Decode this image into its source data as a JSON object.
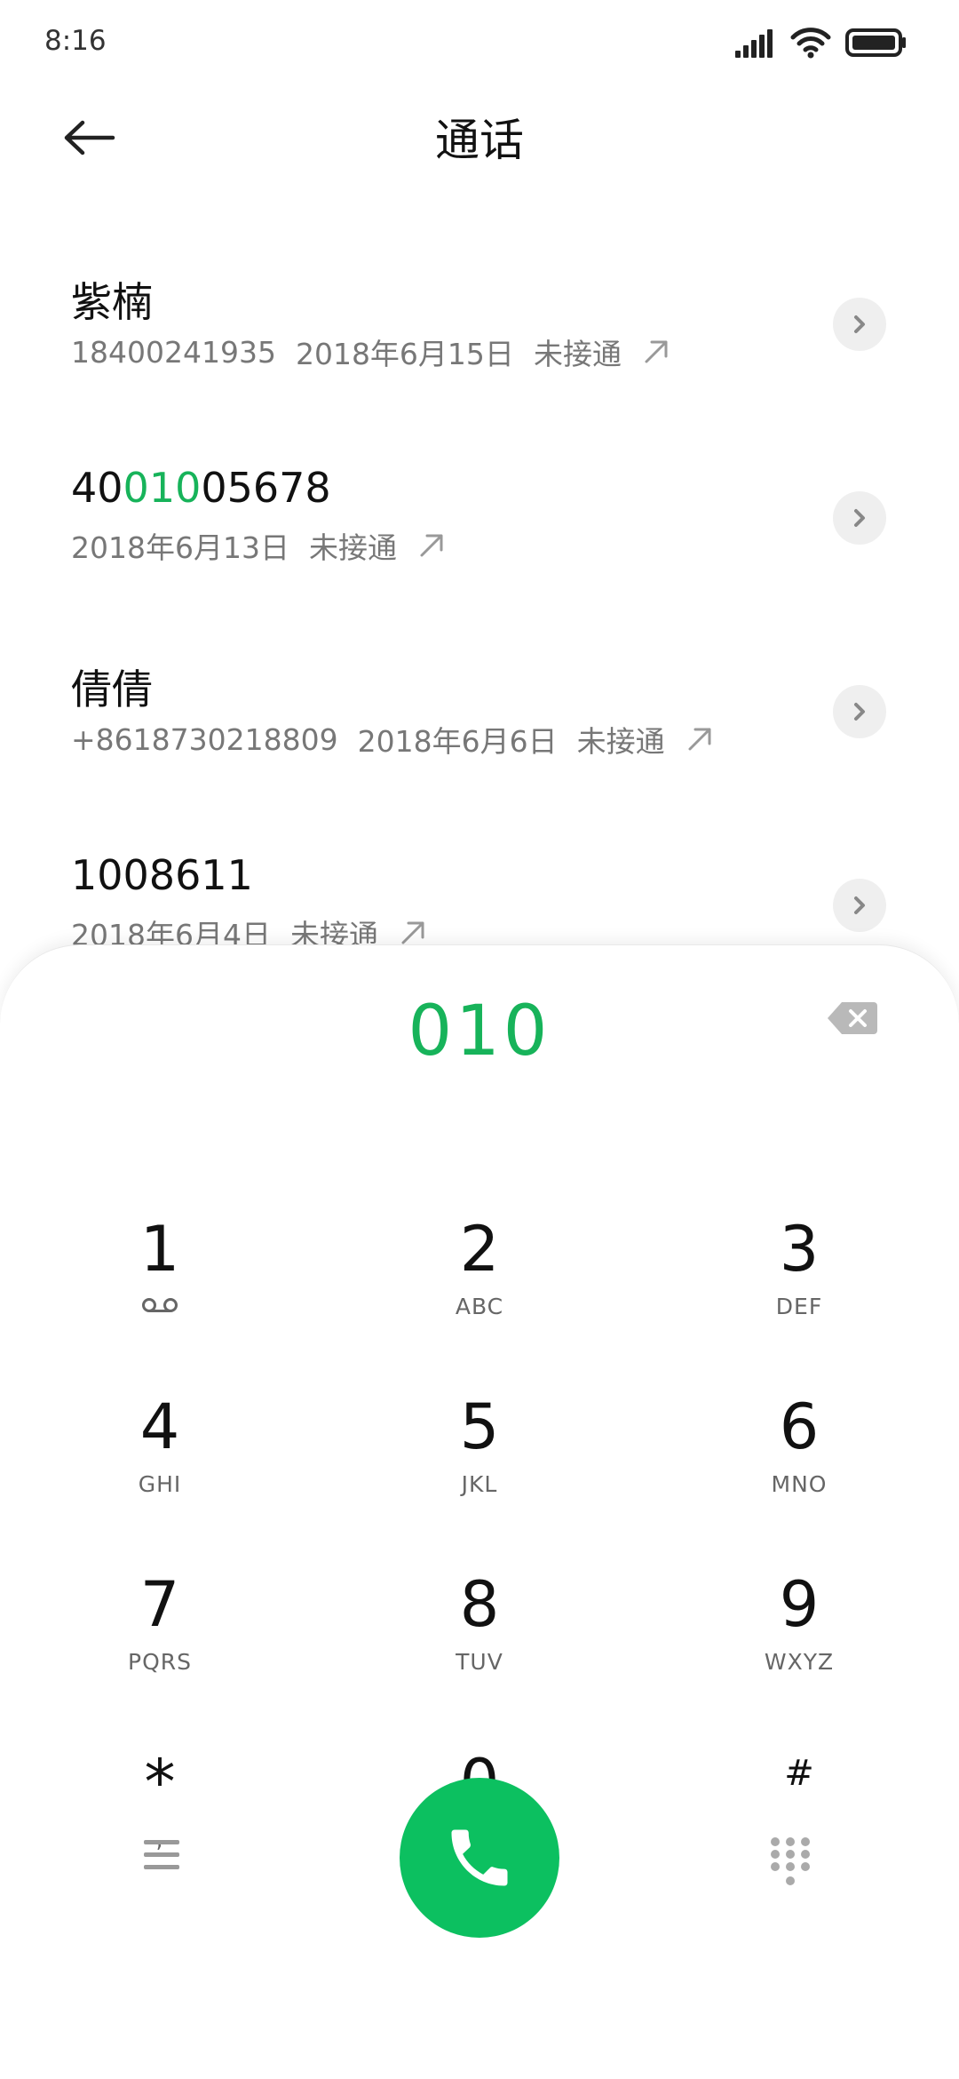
{
  "status_bar": {
    "time": "8:16"
  },
  "header": {
    "title": "通话"
  },
  "calls": [
    {
      "name": "紫楠",
      "number": "18400241935",
      "date": "2018年6月15日",
      "status": "未接通"
    },
    {
      "name_pre": "40",
      "name_match": "010",
      "name_post": "05678",
      "number": "",
      "date": "2018年6月13日",
      "status": "未接通"
    },
    {
      "name": "倩倩",
      "number": "+8618730218809",
      "date": "2018年6月6日",
      "status": "未接通"
    },
    {
      "name": "1008611",
      "number": "",
      "date": "2018年6月4日",
      "status": "未接通"
    }
  ],
  "dialer": {
    "input": "010",
    "keys": [
      {
        "digit": "1",
        "sub": ""
      },
      {
        "digit": "2",
        "sub": "ABC"
      },
      {
        "digit": "3",
        "sub": "DEF"
      },
      {
        "digit": "4",
        "sub": "GHI"
      },
      {
        "digit": "5",
        "sub": "JKL"
      },
      {
        "digit": "6",
        "sub": "MNO"
      },
      {
        "digit": "7",
        "sub": "PQRS"
      },
      {
        "digit": "8",
        "sub": "TUV"
      },
      {
        "digit": "9",
        "sub": "WXYZ"
      },
      {
        "digit": "*",
        "sub": ","
      },
      {
        "digit": "0",
        "sub": "+"
      },
      {
        "digit": "#",
        "sub": ""
      }
    ]
  },
  "colors": {
    "accent": "#17b35a",
    "call_button": "#0cc060"
  },
  "icons": {
    "voicemail": "voicemail-icon",
    "backspace": "backspace-icon",
    "call": "phone-icon",
    "menu": "menu-icon",
    "keypad": "keypad-icon"
  }
}
